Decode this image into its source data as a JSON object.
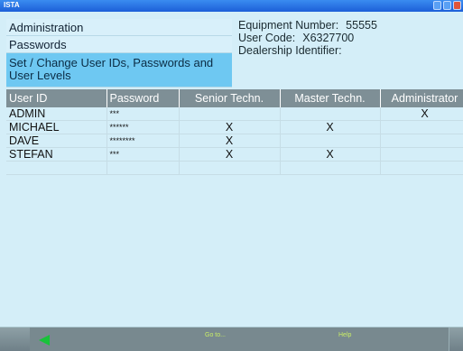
{
  "window": {
    "title": "ISTA"
  },
  "nav": {
    "items": [
      "Administration",
      "Passwords",
      "Set / Change User IDs, Passwords and User Levels"
    ]
  },
  "info": {
    "equipment_label": "Equipment Number:",
    "equipment_value": "55555",
    "user_code_label": "User Code:",
    "user_code_value": "X6327700",
    "dealership_label": "Dealership Identifier:"
  },
  "table": {
    "headers": [
      "User ID",
      "Password",
      "Senior Techn.",
      "Master Techn.",
      "Administrator"
    ],
    "rows": [
      [
        "ADMIN",
        "***",
        "",
        "",
        "X"
      ],
      [
        "MICHAEL",
        "******",
        "X",
        "X",
        ""
      ],
      [
        "DAVE",
        "********",
        "X",
        "",
        ""
      ],
      [
        "STEFAN",
        "***",
        "X",
        "X",
        ""
      ],
      [
        "",
        "",
        "",
        "",
        ""
      ]
    ]
  },
  "footer": {
    "goto_label": "Go to...",
    "help_label": "Help"
  },
  "colors": {
    "accent": "#6ec8f2",
    "header": "#7e8f96",
    "back_arrow": "#18c23a"
  }
}
